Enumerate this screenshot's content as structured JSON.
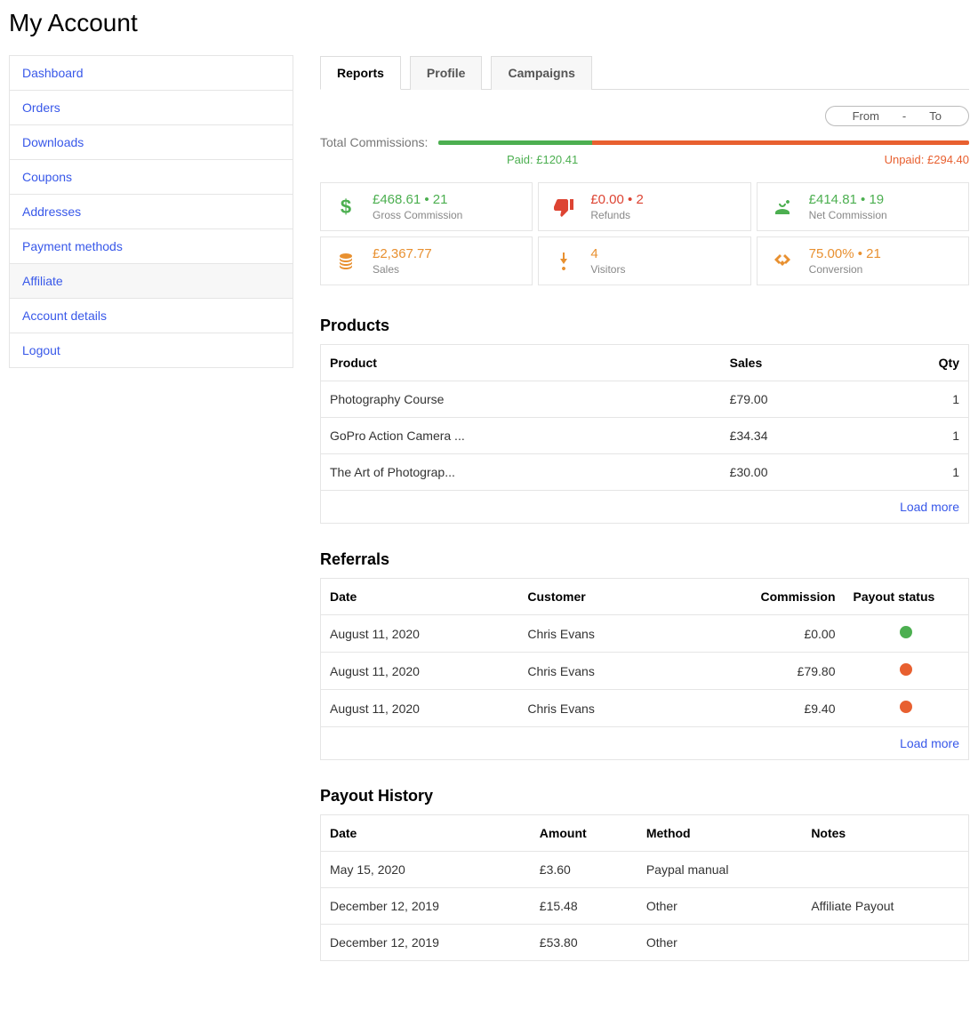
{
  "page_title": "My Account",
  "sidebar": {
    "items": [
      {
        "label": "Dashboard"
      },
      {
        "label": "Orders"
      },
      {
        "label": "Downloads"
      },
      {
        "label": "Coupons"
      },
      {
        "label": "Addresses"
      },
      {
        "label": "Payment methods"
      },
      {
        "label": "Affiliate"
      },
      {
        "label": "Account details"
      },
      {
        "label": "Logout"
      }
    ],
    "active_index": 6
  },
  "tabs": {
    "items": [
      {
        "label": "Reports"
      },
      {
        "label": "Profile"
      },
      {
        "label": "Campaigns"
      }
    ],
    "active_index": 0
  },
  "date_filter": {
    "from_label": "From",
    "sep": "-",
    "to_label": "To"
  },
  "commissions": {
    "label": "Total Commissions:",
    "paid_label": "Paid: £120.41",
    "unpaid_label": "Unpaid: £294.40",
    "paid_pct": 29,
    "unpaid_pct": 71
  },
  "stats": {
    "gross": {
      "value": "£468.61 • 21",
      "label": "Gross Commission",
      "color": "c-green",
      "icon": "dollar"
    },
    "refunds": {
      "value": "£0.00 • 2",
      "label": "Refunds",
      "color": "c-red",
      "icon": "thumbs-down"
    },
    "net": {
      "value": "£414.81 • 19",
      "label": "Net Commission",
      "color": "c-green",
      "icon": "hand-dollar"
    },
    "sales": {
      "value": "£2,367.77",
      "label": "Sales",
      "color": "c-orange",
      "icon": "coins"
    },
    "visitors": {
      "value": "4",
      "label": "Visitors",
      "color": "c-orange",
      "icon": "pointer"
    },
    "conv": {
      "value": "75.00% • 21",
      "label": "Conversion",
      "color": "c-orange",
      "icon": "handshake"
    }
  },
  "products": {
    "heading": "Products",
    "headers": {
      "product": "Product",
      "sales": "Sales",
      "qty": "Qty"
    },
    "rows": [
      {
        "product": "Photography Course",
        "sales": "£79.00",
        "qty": "1"
      },
      {
        "product": "GoPro Action Camera ...",
        "sales": "£34.34",
        "qty": "1"
      },
      {
        "product": "The Art of Photograp...",
        "sales": "£30.00",
        "qty": "1"
      }
    ],
    "load_more": "Load more"
  },
  "referrals": {
    "heading": "Referrals",
    "headers": {
      "date": "Date",
      "customer": "Customer",
      "commission": "Commission",
      "status": "Payout status"
    },
    "rows": [
      {
        "date": "August 11, 2020",
        "customer": "Chris Evans",
        "commission": "£0.00",
        "status": "green"
      },
      {
        "date": "August 11, 2020",
        "customer": "Chris Evans",
        "commission": "£79.80",
        "status": "orange"
      },
      {
        "date": "August 11, 2020",
        "customer": "Chris Evans",
        "commission": "£9.40",
        "status": "orange"
      }
    ],
    "load_more": "Load more"
  },
  "payouts": {
    "heading": "Payout History",
    "headers": {
      "date": "Date",
      "amount": "Amount",
      "method": "Method",
      "notes": "Notes"
    },
    "rows": [
      {
        "date": "May 15, 2020",
        "amount": "£3.60",
        "method": "Paypal manual",
        "notes": ""
      },
      {
        "date": "December 12, 2019",
        "amount": "£15.48",
        "method": "Other",
        "notes": "Affiliate Payout"
      },
      {
        "date": "December 12, 2019",
        "amount": "£53.80",
        "method": "Other",
        "notes": ""
      }
    ]
  }
}
